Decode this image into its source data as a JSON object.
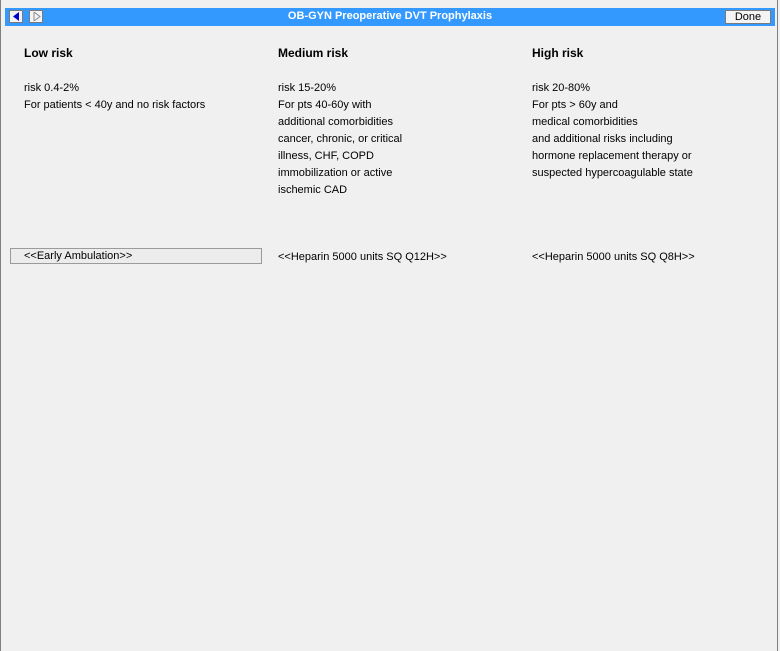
{
  "window": {
    "title": "OB-GYN Preoperative DVT Prophylaxis",
    "done_label": "Done",
    "back_icon": "back-arrow-icon",
    "forward_icon": "forward-arrow-icon"
  },
  "columns": [
    {
      "heading": "Low risk",
      "lines": [
        "risk 0.4-2%",
        "For patients < 40y and no risk factors"
      ],
      "action": "<<Early Ambulation>>"
    },
    {
      "heading": "Medium risk",
      "lines": [
        "risk 15-20%",
        "For pts 40-60y with",
        "additional comorbidities",
        "cancer, chronic, or critical",
        "illness, CHF, COPD",
        "immobilization or active",
        "ischemic CAD"
      ],
      "action": "<<Heparin 5000 units SQ Q12H>>"
    },
    {
      "heading": "High risk",
      "lines": [
        "risk 20-80%",
        "For pts > 60y and",
        "medical comorbidities",
        "and additional risks including",
        "hormone replacement therapy or",
        "suspected hypercoagulable state"
      ],
      "action": "<<Heparin 5000 units SQ Q8H>>"
    }
  ],
  "colors": {
    "titlebar": "#3399ff",
    "background": "#f0f0f0",
    "nav_arrow": "#0000cc"
  }
}
